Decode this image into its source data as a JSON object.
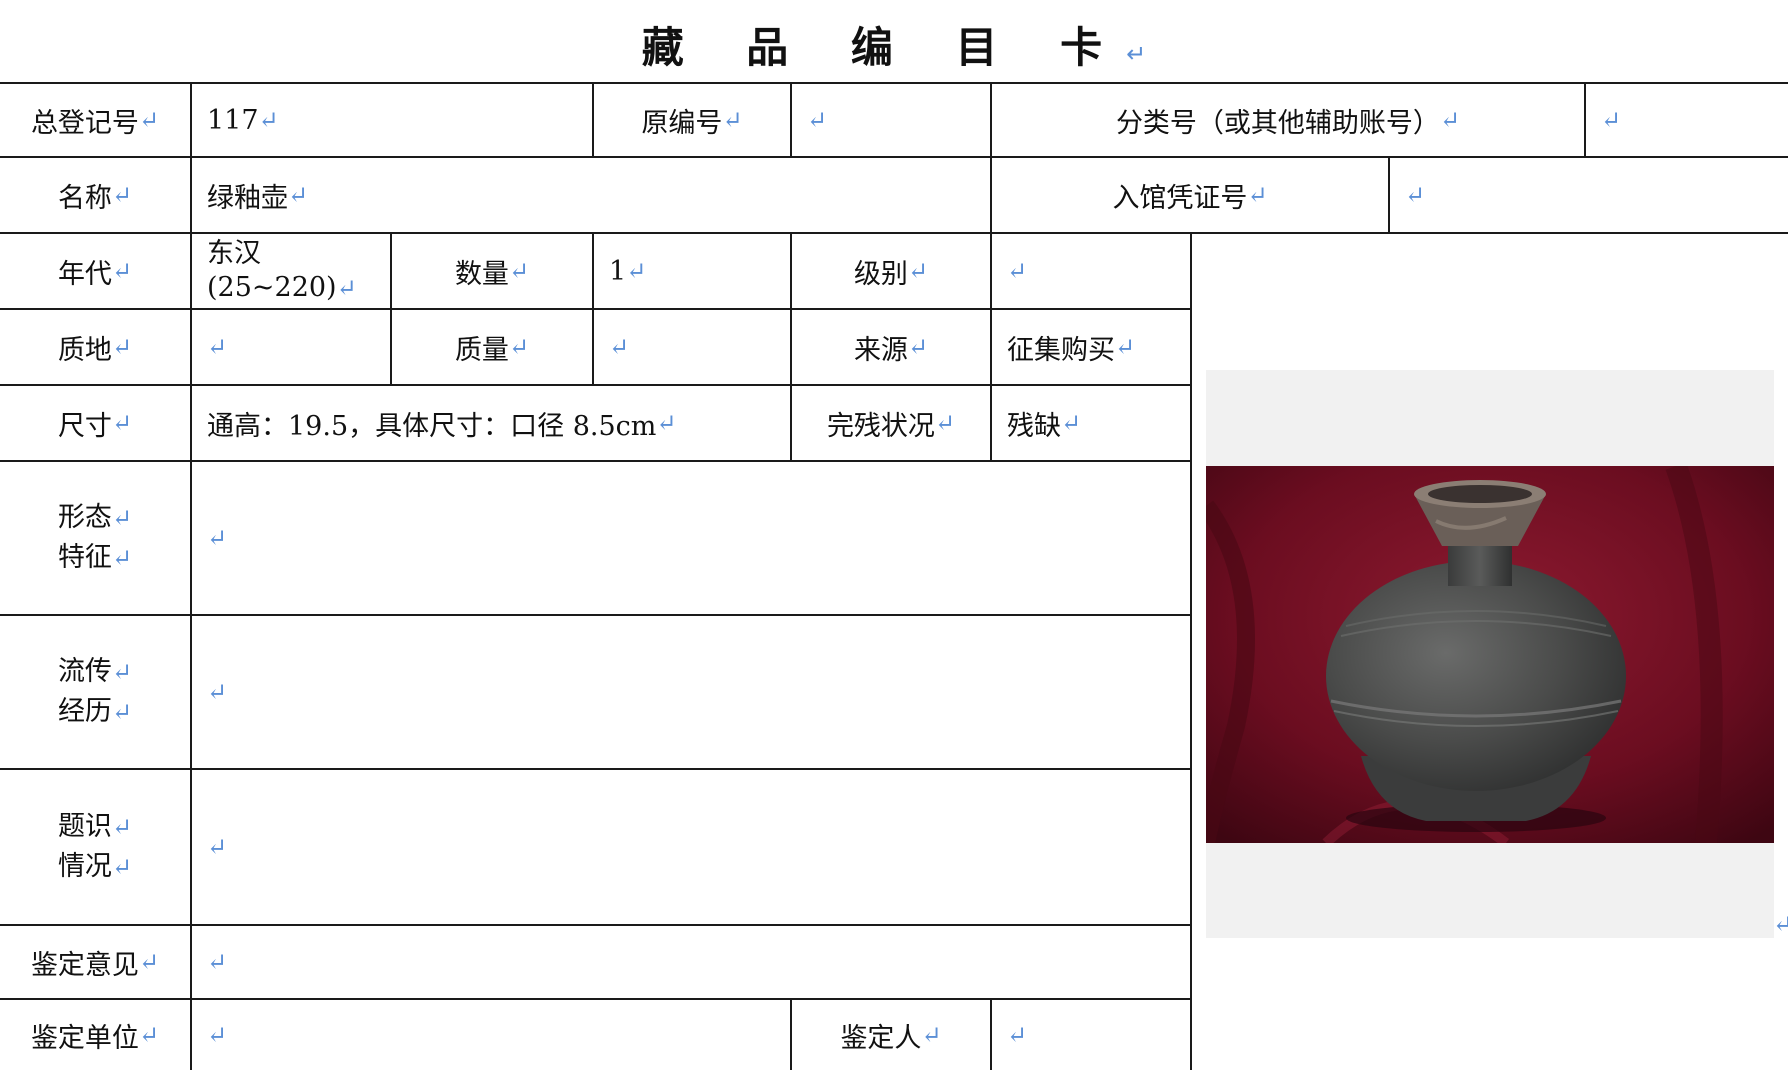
{
  "title": "藏 品 编 目 卡",
  "para_mark": "↵",
  "rows": {
    "r1": {
      "label1": "总登记号",
      "value1": "117",
      "label2": "原编号",
      "value2": "",
      "label3": "分类号（或其他辅助账号）",
      "value3": ""
    },
    "r2": {
      "label1": "名称",
      "value1": "绿釉壶",
      "label2": "入馆凭证号",
      "value2": ""
    },
    "r3": {
      "label1": "年代",
      "value1a": "东汉",
      "value1b": "(25~220)",
      "label2": "数量",
      "value2": "1",
      "label3": "级别",
      "value3": ""
    },
    "r4": {
      "label1": "质地",
      "value1": "",
      "label2": "质量",
      "value2": "",
      "label3": "来源",
      "value3": "征集购买"
    },
    "r5": {
      "label1": "尺寸",
      "value1": "通高：19.5，具体尺寸：口径 8.5cm",
      "label2": "完残状况",
      "value2": "残缺"
    },
    "r6": {
      "label_a": "形态",
      "label_b": "特征",
      "value": ""
    },
    "r7": {
      "label_a": "流传",
      "label_b": "经历",
      "value": ""
    },
    "r8": {
      "label_a": "题识",
      "label_b": "情况",
      "value": ""
    },
    "r9": {
      "label": "鉴定意见",
      "value": ""
    },
    "r10": {
      "label1": "鉴定单位",
      "value1": "",
      "label2": "鉴定人",
      "value2": ""
    }
  },
  "photo": {
    "alt": "pottery-vase-photo"
  },
  "colors": {
    "border": "#1a1a1a",
    "para_mark": "#5b8fd6",
    "velvet": "#7a0f24",
    "pot": "#4a4b4a",
    "photo_bg": "#f1f1f1"
  }
}
